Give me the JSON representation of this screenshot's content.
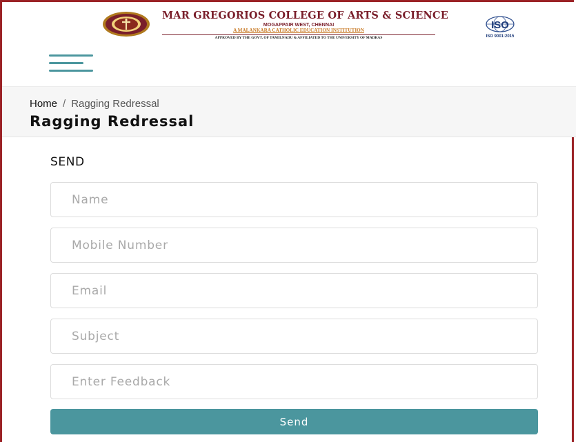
{
  "header": {
    "college_name": "MAR GREGORIOS COLLEGE OF ARTS & SCIENCE",
    "location": "MOGAPPAIR WEST, CHENNAI",
    "tagline": "A MALANKARA CATHOLIC EDUCATION INSTITUTION",
    "approved": "APPROVED BY THE GOVT. OF TAMILNADU & AFFILIATED TO THE UNIVERSITY OF MADRAS",
    "iso_text": "ISO",
    "iso_cert": "ISO 9001:2015",
    "menu_icon": "hamburger-menu-icon"
  },
  "breadcrumb": {
    "home": "Home",
    "separator": "/",
    "current": "Ragging Redressal"
  },
  "page_title": "Ragging Redressal",
  "form": {
    "heading": "SEND",
    "fields": {
      "name": {
        "placeholder": "Name",
        "value": ""
      },
      "mobile": {
        "placeholder": "Mobile Number",
        "value": ""
      },
      "email": {
        "placeholder": "Email",
        "value": ""
      },
      "subject": {
        "placeholder": "Subject",
        "value": ""
      },
      "feedback": {
        "placeholder": "Enter Feedback",
        "value": ""
      }
    },
    "submit_label": "Send"
  },
  "colors": {
    "accent": "#4b969e",
    "brand": "#7a1f2b",
    "frame": "#9b2226"
  }
}
